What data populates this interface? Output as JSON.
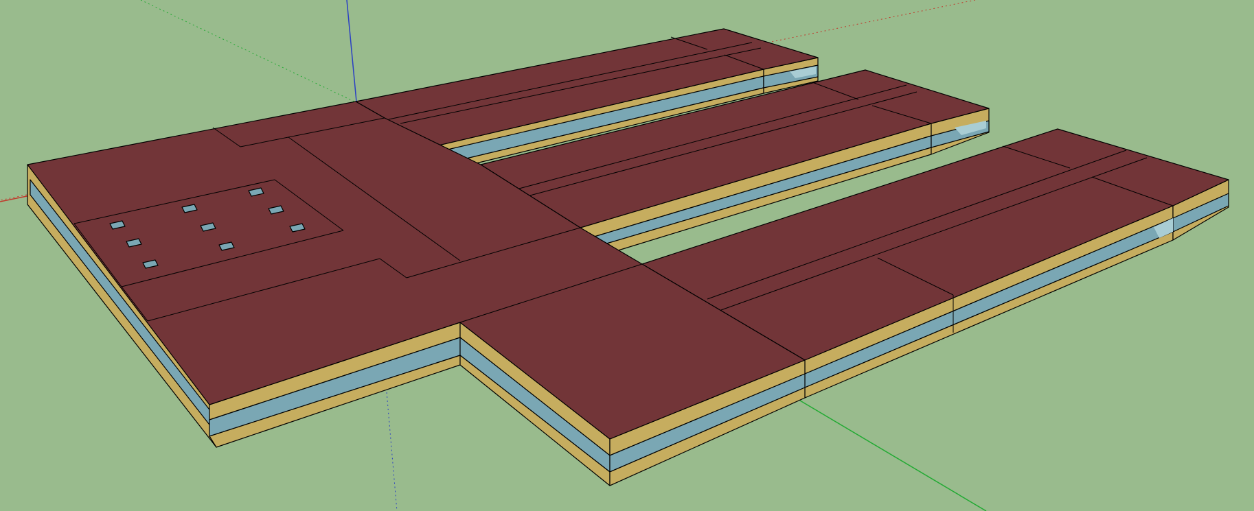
{
  "colors": {
    "ground": "#99bb8d",
    "roof": "#723538",
    "roof_side": "#723538",
    "floor_slab": "#c6ad5f",
    "glazing": "#7aa7b4",
    "glazing_light": "#a9cdd4",
    "edge": "#000000",
    "axis_red": "#c0392b",
    "axis_green": "#22aa33",
    "axis_blue": "#2a3fc4"
  },
  "icons": {
    "axes": "axes-icon",
    "skylight": "skylight-icon"
  }
}
